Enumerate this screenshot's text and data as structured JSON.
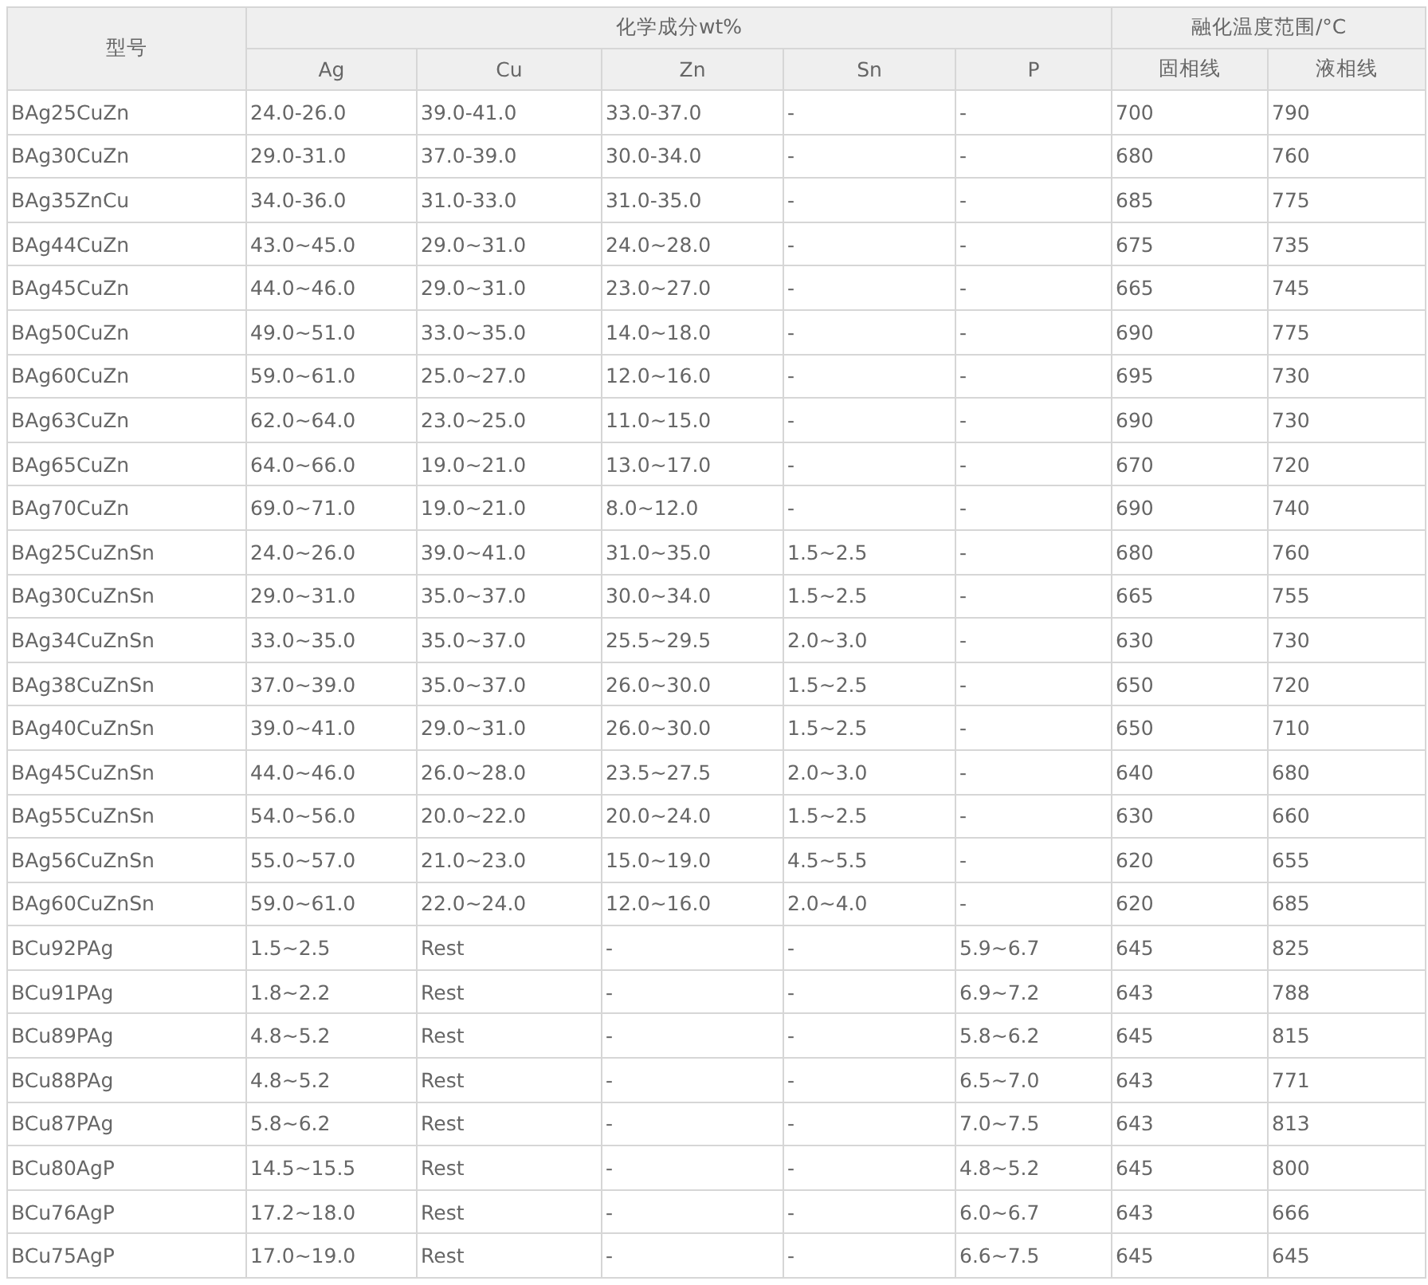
{
  "table": {
    "model_header": "型号",
    "groups": [
      {
        "label": "化学成分wt%",
        "columns": [
          "Ag",
          "Cu",
          "Zn",
          "Sn",
          "P"
        ]
      },
      {
        "label": "融化温度范围/°C",
        "columns": [
          "固相线",
          "液相线"
        ]
      }
    ],
    "rows": [
      [
        "BAg25CuZn",
        "24.0-26.0",
        "39.0-41.0",
        "33.0-37.0",
        "-",
        "-",
        "700",
        "790"
      ],
      [
        "BAg30CuZn",
        "29.0-31.0",
        "37.0-39.0",
        "30.0-34.0",
        "-",
        "-",
        "680",
        "760"
      ],
      [
        "BAg35ZnCu",
        "34.0-36.0",
        "31.0-33.0",
        "31.0-35.0",
        "-",
        "-",
        "685",
        "775"
      ],
      [
        "BAg44CuZn",
        "43.0~45.0",
        "29.0~31.0",
        "24.0~28.0",
        "-",
        "-",
        "675",
        "735"
      ],
      [
        "BAg45CuZn",
        "44.0~46.0",
        "29.0~31.0",
        "23.0~27.0",
        "-",
        "-",
        "665",
        "745"
      ],
      [
        "BAg50CuZn",
        "49.0~51.0",
        "33.0~35.0",
        "14.0~18.0",
        "-",
        "-",
        "690",
        "775"
      ],
      [
        "BAg60CuZn",
        "59.0~61.0",
        "25.0~27.0",
        "12.0~16.0",
        "-",
        "-",
        "695",
        "730"
      ],
      [
        "BAg63CuZn",
        "62.0~64.0",
        "23.0~25.0",
        "11.0~15.0",
        "-",
        "-",
        "690",
        "730"
      ],
      [
        "BAg65CuZn",
        "64.0~66.0",
        "19.0~21.0",
        "13.0~17.0",
        "-",
        "-",
        "670",
        "720"
      ],
      [
        "BAg70CuZn",
        "69.0~71.0",
        "19.0~21.0",
        "8.0~12.0",
        "-",
        "-",
        "690",
        "740"
      ],
      [
        "BAg25CuZnSn",
        "24.0~26.0",
        "39.0~41.0",
        "31.0~35.0",
        "1.5~2.5",
        "-",
        "680",
        "760"
      ],
      [
        "BAg30CuZnSn",
        "29.0~31.0",
        "35.0~37.0",
        "30.0~34.0",
        "1.5~2.5",
        "-",
        "665",
        "755"
      ],
      [
        "BAg34CuZnSn",
        "33.0~35.0",
        "35.0~37.0",
        "25.5~29.5",
        "2.0~3.0",
        "-",
        "630",
        "730"
      ],
      [
        "BAg38CuZnSn",
        "37.0~39.0",
        "35.0~37.0",
        "26.0~30.0",
        "1.5~2.5",
        "-",
        "650",
        "720"
      ],
      [
        "BAg40CuZnSn",
        "39.0~41.0",
        "29.0~31.0",
        "26.0~30.0",
        "1.5~2.5",
        "-",
        "650",
        "710"
      ],
      [
        "BAg45CuZnSn",
        "44.0~46.0",
        "26.0~28.0",
        "23.5~27.5",
        "2.0~3.0",
        "-",
        "640",
        "680"
      ],
      [
        "BAg55CuZnSn",
        "54.0~56.0",
        "20.0~22.0",
        "20.0~24.0",
        "1.5~2.5",
        "-",
        "630",
        "660"
      ],
      [
        "BAg56CuZnSn",
        "55.0~57.0",
        "21.0~23.0",
        "15.0~19.0",
        "4.5~5.5",
        "-",
        "620",
        "655"
      ],
      [
        "BAg60CuZnSn",
        "59.0~61.0",
        "22.0~24.0",
        "12.0~16.0",
        "2.0~4.0",
        "-",
        "620",
        "685"
      ],
      [
        "BCu92PAg",
        "1.5~2.5",
        "Rest",
        "-",
        "-",
        "5.9~6.7",
        "645",
        "825"
      ],
      [
        "BCu91PAg",
        "1.8~2.2",
        "Rest",
        "-",
        "-",
        "6.9~7.2",
        "643",
        "788"
      ],
      [
        "BCu89PAg",
        "4.8~5.2",
        "Rest",
        "-",
        "-",
        "5.8~6.2",
        "645",
        "815"
      ],
      [
        "BCu88PAg",
        "4.8~5.2",
        "Rest",
        "-",
        "-",
        "6.5~7.0",
        "643",
        "771"
      ],
      [
        "BCu87PAg",
        "5.8~6.2",
        "Rest",
        "-",
        "-",
        "7.0~7.5",
        "643",
        "813"
      ],
      [
        "BCu80AgP",
        "14.5~15.5",
        "Rest",
        "-",
        "-",
        "4.8~5.2",
        "645",
        "800"
      ],
      [
        "BCu76AgP",
        "17.2~18.0",
        "Rest",
        "-",
        "-",
        "6.0~6.7",
        "643",
        "666"
      ],
      [
        "BCu75AgP",
        "17.0~19.0",
        "Rest",
        "-",
        "-",
        "6.6~7.5",
        "645",
        "645"
      ]
    ]
  }
}
